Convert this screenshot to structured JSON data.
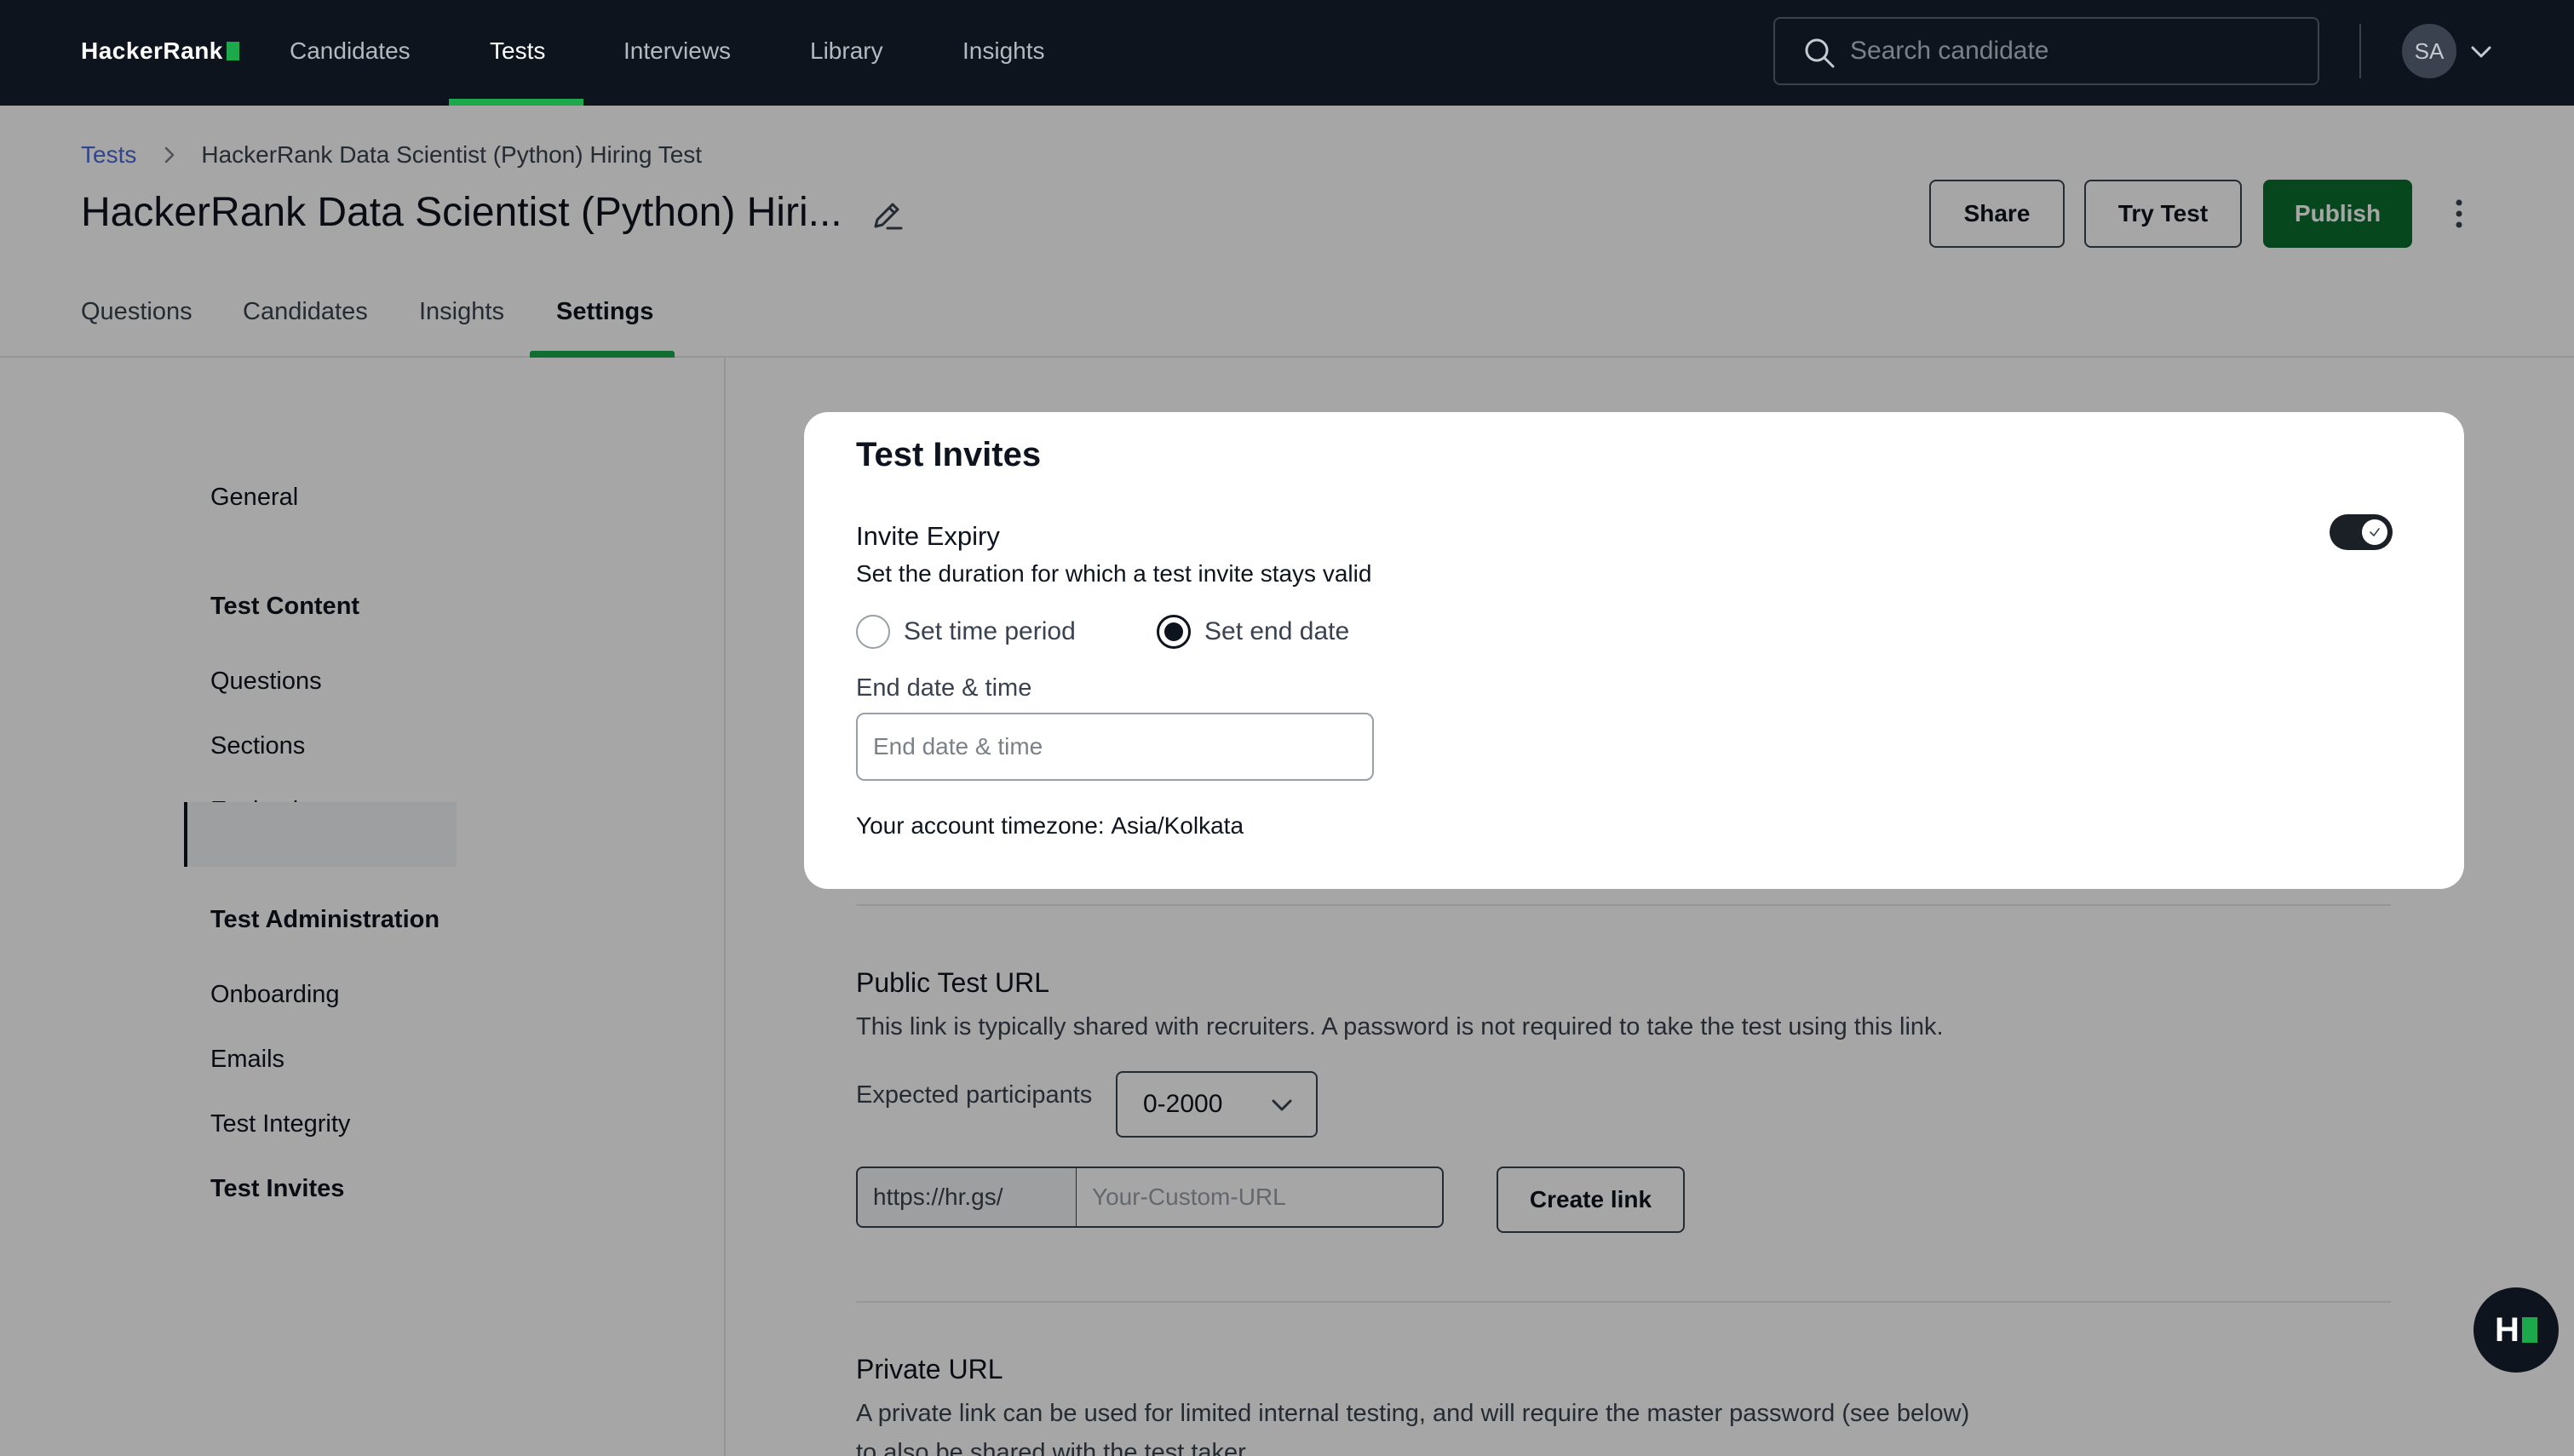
{
  "brand": {
    "name": "HackerRank",
    "accent_color": "#1ba94c",
    "nav_bg": "#0e141e"
  },
  "topnav": {
    "items": [
      {
        "label": "Candidates"
      },
      {
        "label": "Tests"
      },
      {
        "label": "Interviews"
      },
      {
        "label": "Library"
      },
      {
        "label": "Insights"
      }
    ],
    "active": "Tests",
    "search": {
      "placeholder": "Search candidate",
      "icon": "search-icon"
    },
    "avatar_initials": "SA"
  },
  "breadcrumb": {
    "root": "Tests",
    "current": "HackerRank Data Scientist (Python) Hiring Test"
  },
  "page": {
    "title": "HackerRank Data Scientist (Python) Hiri...",
    "actions": {
      "share": "Share",
      "try_test": "Try Test",
      "publish": "Publish"
    }
  },
  "tabs": [
    {
      "label": "Questions"
    },
    {
      "label": "Candidates"
    },
    {
      "label": "Insights"
    },
    {
      "label": "Settings"
    }
  ],
  "active_tab": "Settings",
  "sidebar": {
    "general": "General",
    "content_heading": "Test Content",
    "content_items": [
      "Questions",
      "Sections",
      "Evaluation"
    ],
    "admin_heading": "Test Administration",
    "admin_items": [
      "Onboarding",
      "Emails",
      "Test Integrity",
      "Test Invites"
    ],
    "active": "Test Invites"
  },
  "public_url": {
    "title": "Public Test URL",
    "description": "This link is typically shared with recruiters. A password is not required to take the test using this link.",
    "expected_label": "Expected participants",
    "expected_value": "0-2000",
    "prefix": "https://hr.gs/",
    "custom_placeholder": "Your-Custom-URL",
    "create_button": "Create link"
  },
  "private_url": {
    "title": "Private URL",
    "description_line1": "A private link can be used for limited internal testing, and will require the master password (see below)",
    "description_line2": "to also be shared with the test taker."
  },
  "modal": {
    "title": "Test Invites",
    "expiry_label": "Invite Expiry",
    "expiry_desc": "Set the duration for which a test invite stays valid",
    "toggle_on": true,
    "option_time_period": "Set time period",
    "option_end_date": "Set end date",
    "selected_option": "Set end date",
    "end_label": "End date & time",
    "end_placeholder": "End date & time",
    "tz_label": "Your account timezone:",
    "tz_value": "Asia/Kolkata"
  },
  "help_fab": {
    "label": "H"
  }
}
